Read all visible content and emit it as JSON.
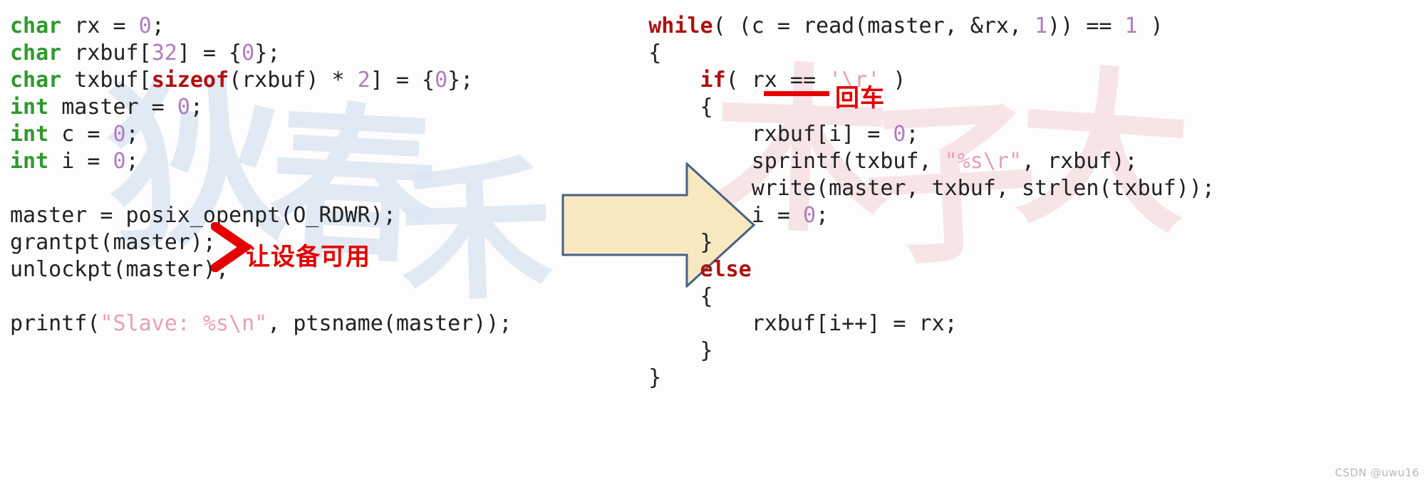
{
  "meta": {
    "background_color": "#fdfdfd",
    "watermark_footer": "CSDN @uwu16"
  },
  "watermarks": {
    "blue": [
      "狄",
      "春",
      "禾"
    ],
    "pink": [
      "木",
      "子",
      "大"
    ]
  },
  "code_left": {
    "language": "c",
    "lines": [
      [
        {
          "t": "char",
          "c": "kw"
        },
        {
          "t": " rx = ",
          "c": "pl"
        },
        {
          "t": "0",
          "c": "num"
        },
        {
          "t": ";",
          "c": "pl"
        }
      ],
      [
        {
          "t": "char",
          "c": "kw"
        },
        {
          "t": " rxbuf[",
          "c": "pl"
        },
        {
          "t": "32",
          "c": "num"
        },
        {
          "t": "] = {",
          "c": "pl"
        },
        {
          "t": "0",
          "c": "num"
        },
        {
          "t": "};",
          "c": "pl"
        }
      ],
      [
        {
          "t": "char",
          "c": "kw"
        },
        {
          "t": " txbuf[",
          "c": "pl"
        },
        {
          "t": "sizeof",
          "c": "kw2"
        },
        {
          "t": "(rxbuf) * ",
          "c": "pl"
        },
        {
          "t": "2",
          "c": "num"
        },
        {
          "t": "] = {",
          "c": "pl"
        },
        {
          "t": "0",
          "c": "num"
        },
        {
          "t": "};",
          "c": "pl"
        }
      ],
      [
        {
          "t": "int",
          "c": "kw"
        },
        {
          "t": " master = ",
          "c": "pl"
        },
        {
          "t": "0",
          "c": "num"
        },
        {
          "t": ";",
          "c": "pl"
        }
      ],
      [
        {
          "t": "int",
          "c": "kw"
        },
        {
          "t": " c = ",
          "c": "pl"
        },
        {
          "t": "0",
          "c": "num"
        },
        {
          "t": ";",
          "c": "pl"
        }
      ],
      [
        {
          "t": "int",
          "c": "kw"
        },
        {
          "t": " i = ",
          "c": "pl"
        },
        {
          "t": "0",
          "c": "num"
        },
        {
          "t": ";",
          "c": "pl"
        }
      ],
      [],
      [
        {
          "t": "master = posix_openpt(O_RDWR);",
          "c": "pl"
        }
      ],
      [
        {
          "t": "grantpt(master);",
          "c": "pl"
        }
      ],
      [
        {
          "t": "unlockpt(master);",
          "c": "pl"
        }
      ],
      [],
      [
        {
          "t": "printf(",
          "c": "pl"
        },
        {
          "t": "\"Slave: %s\\n\"",
          "c": "str"
        },
        {
          "t": ", ptsname(master));",
          "c": "pl"
        }
      ]
    ],
    "plain_text": "char rx = 0;\nchar rxbuf[32] = {0};\nchar txbuf[sizeof(rxbuf) * 2] = {0};\nint master = 0;\nint c = 0;\nint i = 0;\n\nmaster = posix_openpt(O_RDWR);\ngrantpt(master);\nunlockpt(master);\n\nprintf(\"Slave: %s\\n\", ptsname(master));"
  },
  "code_right": {
    "language": "c",
    "lines": [
      [
        {
          "t": "    ",
          "c": "pl"
        },
        {
          "t": "while",
          "c": "kw2"
        },
        {
          "t": "( (c = read(master, &rx, ",
          "c": "pl"
        },
        {
          "t": "1",
          "c": "num"
        },
        {
          "t": ")) == ",
          "c": "pl"
        },
        {
          "t": "1",
          "c": "num"
        },
        {
          "t": " )",
          "c": "pl"
        }
      ],
      [
        {
          "t": "    {",
          "c": "pl"
        }
      ],
      [
        {
          "t": "        ",
          "c": "pl"
        },
        {
          "t": "if",
          "c": "kw2"
        },
        {
          "t": "( rx == ",
          "c": "pl"
        },
        {
          "t": "'\\r'",
          "c": "str"
        },
        {
          "t": " )",
          "c": "pl"
        }
      ],
      [
        {
          "t": "        {",
          "c": "pl"
        }
      ],
      [
        {
          "t": "            rxbuf[i] = ",
          "c": "pl"
        },
        {
          "t": "0",
          "c": "num"
        },
        {
          "t": ";",
          "c": "pl"
        }
      ],
      [
        {
          "t": "            sprintf(txbuf, ",
          "c": "pl"
        },
        {
          "t": "\"%s\\r\"",
          "c": "str"
        },
        {
          "t": ", rxbuf);",
          "c": "pl"
        }
      ],
      [
        {
          "t": "            write(master, txbuf, strlen(txbuf));",
          "c": "pl"
        }
      ],
      [
        {
          "t": "            i = ",
          "c": "pl"
        },
        {
          "t": "0",
          "c": "num"
        },
        {
          "t": ";",
          "c": "pl"
        }
      ],
      [
        {
          "t": "        }",
          "c": "pl"
        }
      ],
      [
        {
          "t": "        ",
          "c": "pl"
        },
        {
          "t": "else",
          "c": "kw2"
        }
      ],
      [
        {
          "t": "        {",
          "c": "pl"
        }
      ],
      [
        {
          "t": "            rxbuf[i++] = rx;",
          "c": "pl"
        }
      ],
      [
        {
          "t": "        }",
          "c": "pl"
        }
      ],
      [
        {
          "t": "    }",
          "c": "pl"
        }
      ]
    ],
    "plain_text": "    while( (c = read(master, &rx, 1)) == 1 )\n    {\n        if( rx == '\\r' )\n        {\n            rxbuf[i] = 0;\n            sprintf(txbuf, \"%s\\r\", rxbuf);\n            write(master, txbuf, strlen(txbuf));\n            i = 0;\n        }\n        else\n        {\n            rxbuf[i++] = rx;\n        }\n    }"
  },
  "annotations": {
    "left": {
      "text": "让设备可用",
      "color": "#e60000",
      "marker": "chevron-right"
    },
    "right": {
      "text": "回车",
      "color": "#e60000",
      "marker": "underline",
      "underlines_token": "'\\r'"
    }
  },
  "arrow": {
    "name": "block-arrow-right",
    "fill": "#f7e8c0",
    "stroke": "#4a5f86"
  },
  "syntax_colors": {
    "keyword_type": "#2e9a2e",
    "keyword_control": "#b01010",
    "number": "#b07cc0",
    "string": "#e8a0b4",
    "plain": "#222222"
  }
}
